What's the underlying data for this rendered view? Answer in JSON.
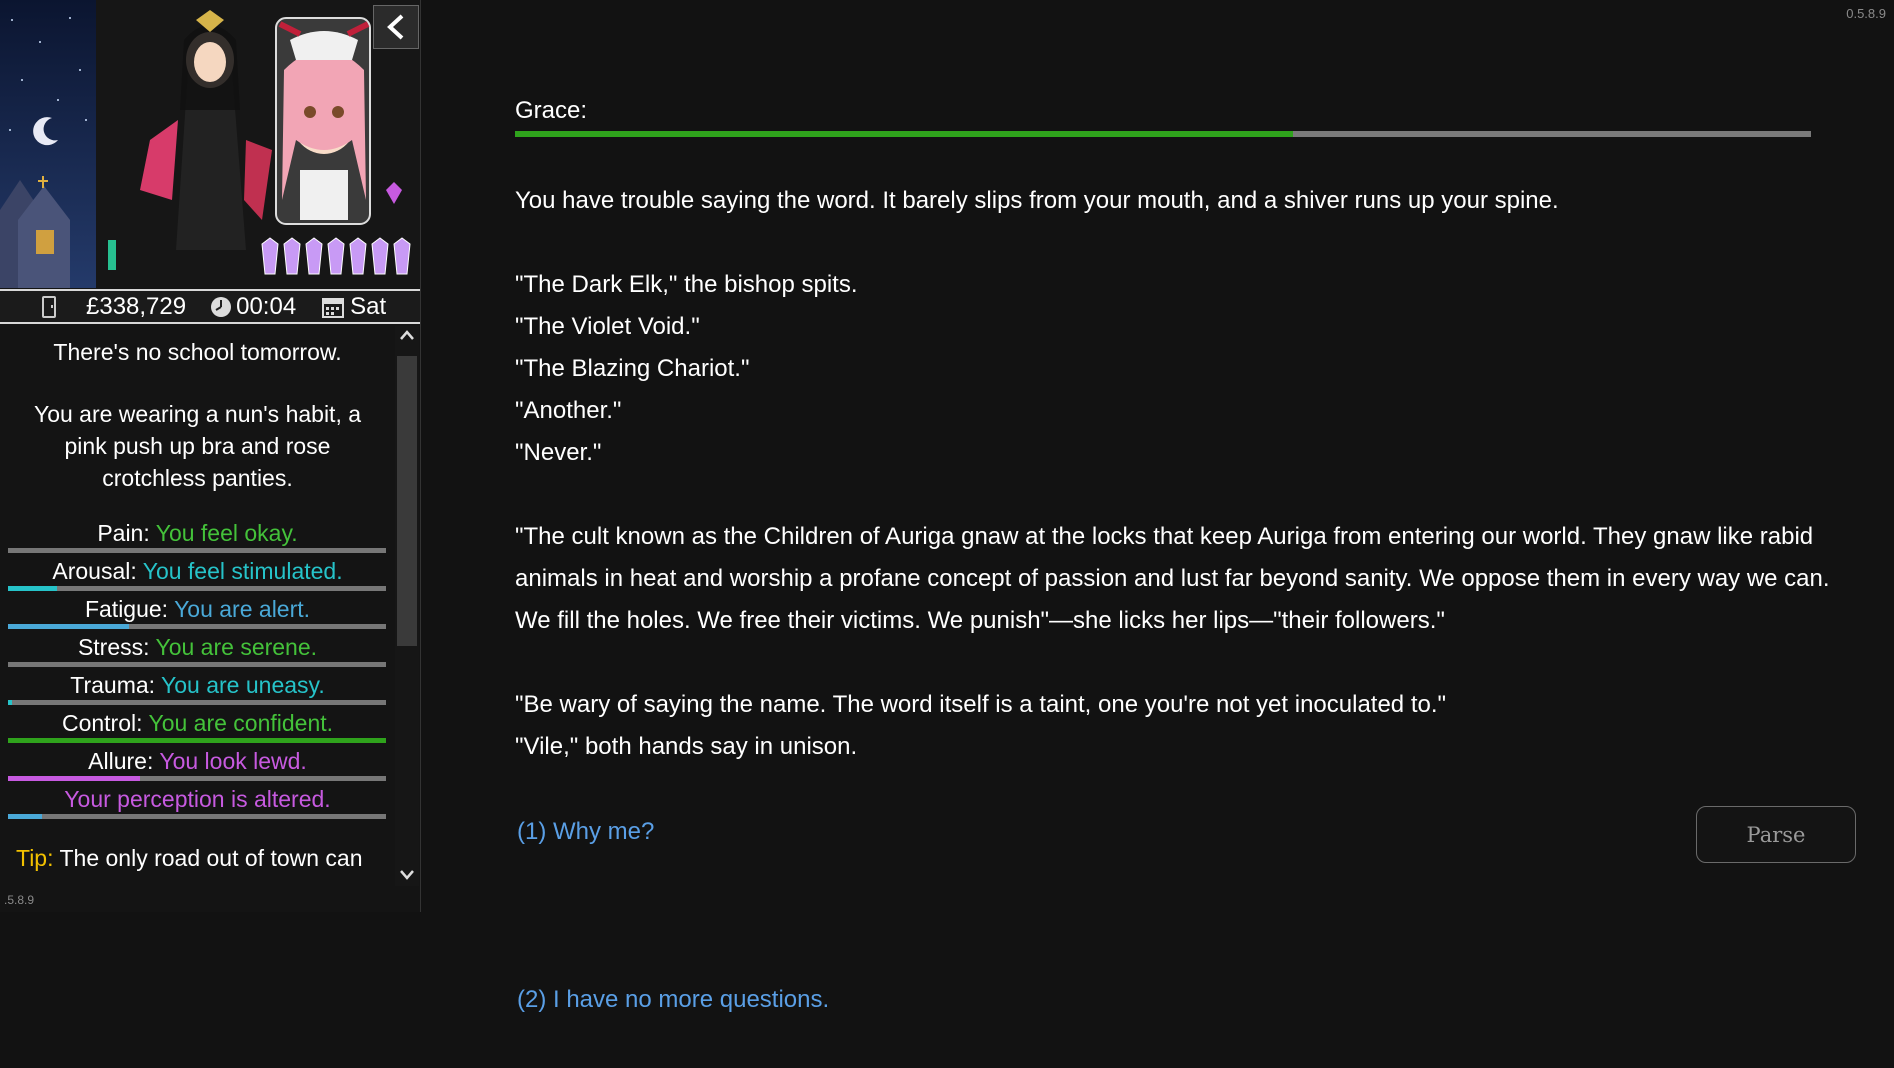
{
  "version": "0.5.8.9",
  "sidebar_version": ".5.8.9",
  "colors": {
    "green": "#44c23a",
    "teal": "#26c3c9",
    "light_blue": "#4aa9d8",
    "purple": "#c75ae0",
    "tip_yellow": "#f2c100",
    "link_blue": "#5a9fe6"
  },
  "status": {
    "phone_icon": "phone-icon",
    "money": "£338,729",
    "clock_icon": "clock-icon",
    "time": "00:04",
    "calendar_icon": "calendar-icon",
    "day": "Sat"
  },
  "sidebar": {
    "school_text": "There's no school tomorrow.",
    "clothing_text": "You are wearing a nun's habit, a pink push up bra and rose crotchless panties.",
    "stats": [
      {
        "label": "Pain:",
        "value": "You feel okay.",
        "color": "#44c23a",
        "bar_fraction": 0.0,
        "bar_color": "#44c23a"
      },
      {
        "label": "Arousal:",
        "value": "You feel stimulated.",
        "color": "#26c3c9",
        "bar_fraction": 0.13,
        "bar_color": "#26c3c9"
      },
      {
        "label": "Fatigue:",
        "value": "You are alert.",
        "color": "#4aa9d8",
        "bar_fraction": 0.32,
        "bar_color": "#4aa9d8"
      },
      {
        "label": "Stress:",
        "value": "You are serene.",
        "color": "#44c23a",
        "bar_fraction": 0.0,
        "bar_color": "#44c23a"
      },
      {
        "label": "Trauma:",
        "value": "You are uneasy.",
        "color": "#26c3c9",
        "bar_fraction": 0.01,
        "bar_color": "#26c3c9"
      },
      {
        "label": "Control:",
        "value": "You are confident.",
        "color": "#44c23a",
        "bar_fraction": 1.0,
        "bar_color": "#2fa31c"
      },
      {
        "label": "Allure:",
        "value": "You look lewd.",
        "color": "#c75ae0",
        "bar_fraction": 0.35,
        "bar_color": "#c75ae0"
      },
      {
        "label": "",
        "value": "Your perception is altered.",
        "color": "#c75ae0",
        "bar_fraction": 0.09,
        "bar_color": "#4aa9d8"
      }
    ],
    "tip_label": "Tip:",
    "tip_text": "The only road out of town can"
  },
  "main": {
    "speaker": "Grace:",
    "grace_fraction": 0.6,
    "paragraphs": [
      [
        "You have trouble saying the word. It barely slips from your mouth, and a shiver runs up your spine."
      ],
      [
        "\"The Dark Elk,\" the bishop spits.",
        "\"The Violet Void.\"",
        "\"The Blazing Chariot.\"",
        "\"Another.\"",
        "\"Never.\""
      ],
      [
        "\"The cult known as the Children of Auriga gnaw at the locks that keep Auriga from entering our world. They gnaw like rabid animals in heat and worship a profane concept of passion and lust far beyond sanity. We oppose them in every way we can. We fill the holes. We free their victims. We punish\"—she licks her lips—\"their followers.\""
      ],
      [
        "\"Be wary of saying the name. The word itself is a taint, one you're not yet inoculated to.\"",
        "\"Vile,\" both hands say in unison."
      ]
    ],
    "choice_1": "(1) Why me?",
    "choice_2": "(2) I have no more questions.",
    "parse_label": "Parse"
  }
}
